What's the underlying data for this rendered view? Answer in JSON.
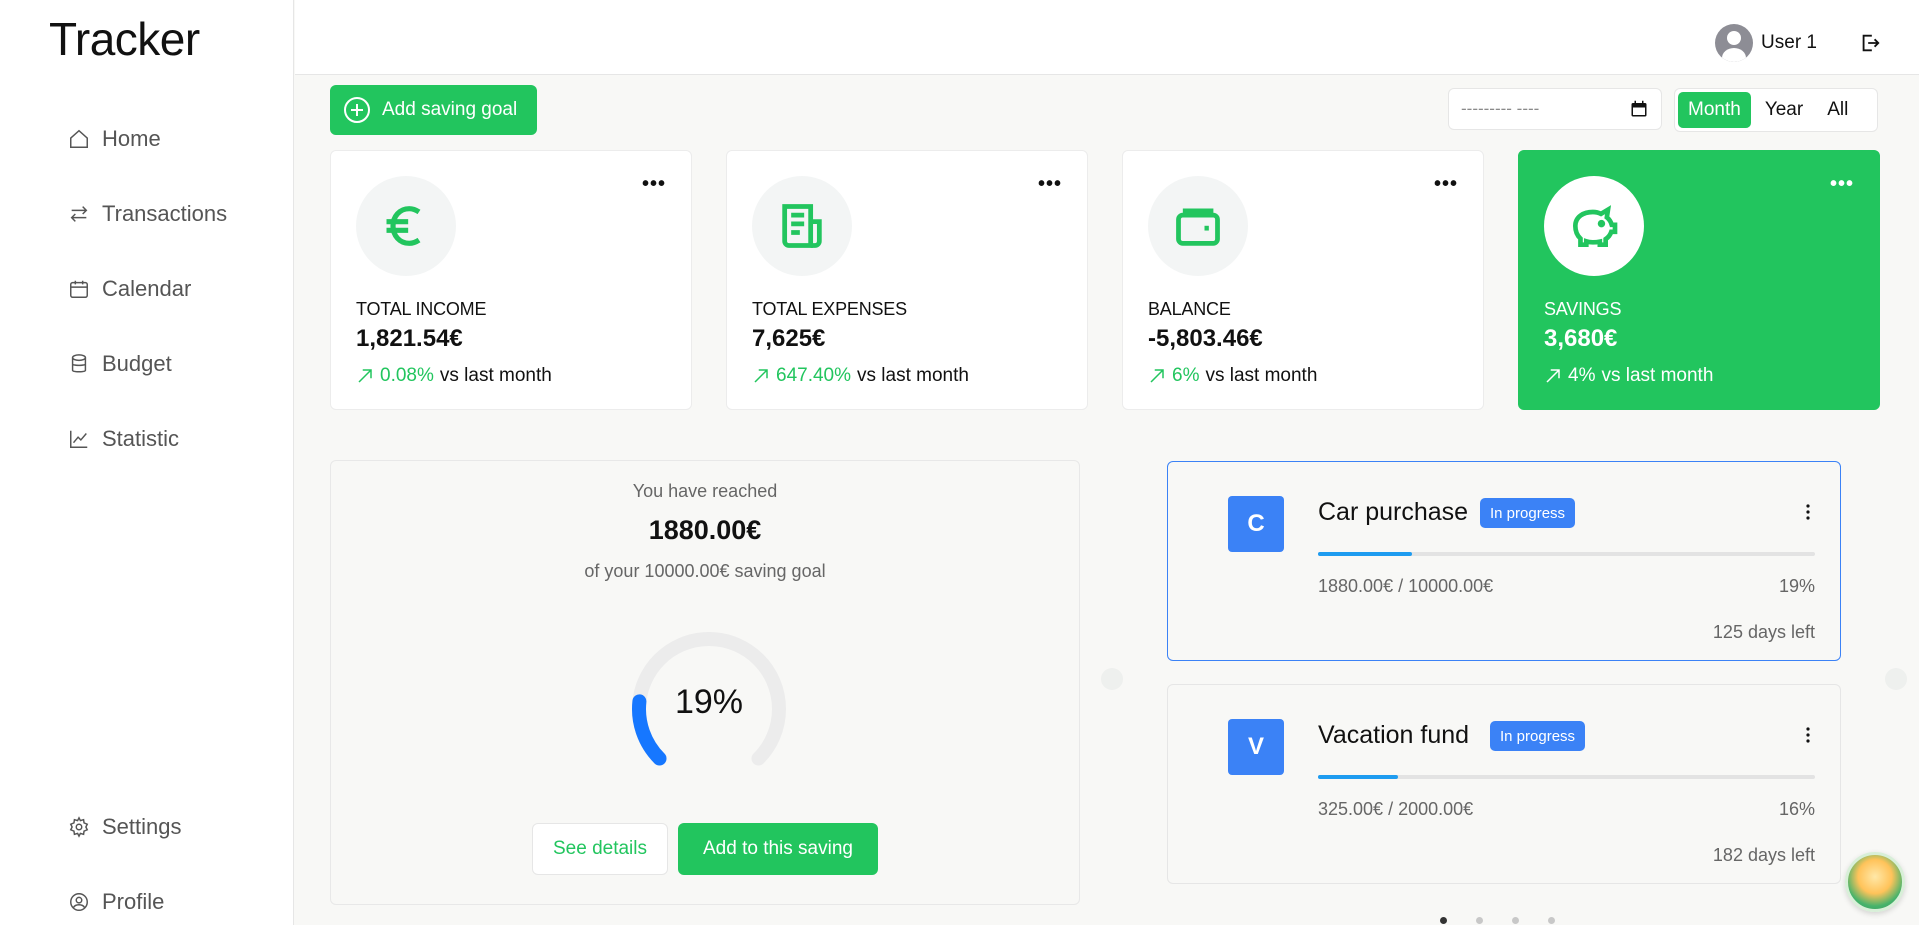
{
  "app": {
    "title": "Tracker"
  },
  "sidebar": {
    "items": [
      {
        "label": "Home",
        "icon": "home-icon"
      },
      {
        "label": "Transactions",
        "icon": "arrows-exchange-icon"
      },
      {
        "label": "Calendar",
        "icon": "calendar-icon"
      },
      {
        "label": "Budget",
        "icon": "database-icon"
      },
      {
        "label": "Statistic",
        "icon": "chart-line-icon"
      }
    ],
    "bottom": [
      {
        "label": "Settings",
        "icon": "gear-icon"
      },
      {
        "label": "Profile",
        "icon": "user-circle-icon"
      }
    ]
  },
  "header": {
    "user": "User 1"
  },
  "toolbar": {
    "add_goal_label": "Add saving goal",
    "date_placeholder": "--------- ----",
    "periods": [
      "Month",
      "Year",
      "All"
    ],
    "active_period": "Month"
  },
  "stats": [
    {
      "label": "TOTAL INCOME",
      "value": "1,821.54€",
      "pct": "0.08%",
      "suffix": "vs last month",
      "icon": "euro-icon"
    },
    {
      "label": "TOTAL EXPENSES",
      "value": "7,625€",
      "pct": "647.40%",
      "suffix": "vs last month",
      "icon": "receipt-icon"
    },
    {
      "label": "BALANCE",
      "value": "-5,803.46€",
      "pct": "6%",
      "suffix": "vs last month",
      "icon": "wallet-icon"
    },
    {
      "label": "SAVINGS",
      "value": "3,680€",
      "pct": "4%",
      "suffix": "vs last month",
      "icon": "piggy-bank-icon"
    }
  ],
  "goal_summary": {
    "reached_label": "You have reached",
    "reached_amount": "1880.00€",
    "subtitle": "of your 10000.00€ saving goal",
    "percent_text": "19%",
    "progress": 0.19,
    "see_details_label": "See details",
    "add_label": "Add to this saving"
  },
  "goals": [
    {
      "letter": "C",
      "name": "Car purchase",
      "status": "In progress",
      "amount": "1880.00€ / 10000.00€",
      "percent": "19%",
      "progress": 0.19,
      "days_left": "125 days left"
    },
    {
      "letter": "V",
      "name": "Vacation fund",
      "status": "In progress",
      "amount": "325.00€ / 2000.00€",
      "percent": "16%",
      "progress": 0.16,
      "days_left": "182 days left"
    }
  ],
  "colors": {
    "accent": "#22c55e",
    "blue": "#3b82f6",
    "progress": "#1e9cf0"
  }
}
